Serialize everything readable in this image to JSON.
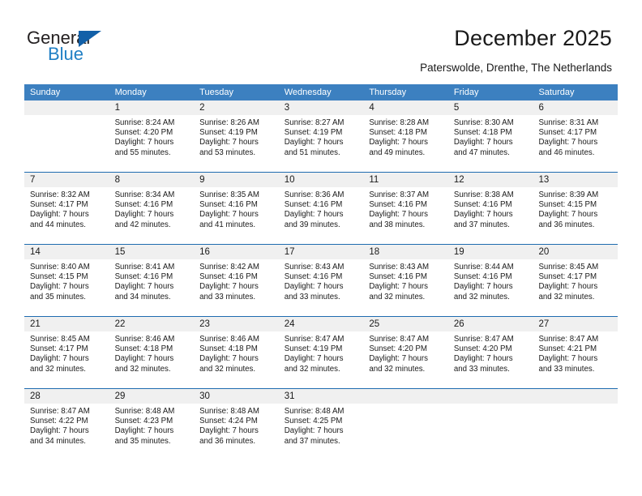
{
  "brand": {
    "name_part1": "General",
    "name_part2": "Blue",
    "logo_icon": "triangle-flag-icon",
    "accent_color": "#1260a8",
    "blue_text_color": "#1f7fc4"
  },
  "header": {
    "title": "December 2025",
    "subtitle": "Paterswolde, Drenthe, The Netherlands"
  },
  "calendar": {
    "header_bg": "#3c80c0",
    "separator_color": "#1f6cb0",
    "daynum_band_bg": "#f0f0f0",
    "weekdays": [
      "Sunday",
      "Monday",
      "Tuesday",
      "Wednesday",
      "Thursday",
      "Friday",
      "Saturday"
    ],
    "weeks": [
      [
        {
          "day": "",
          "sunrise": "",
          "sunset": "",
          "daylight_line1": "",
          "daylight_line2": ""
        },
        {
          "day": "1",
          "sunrise": "Sunrise: 8:24 AM",
          "sunset": "Sunset: 4:20 PM",
          "daylight_line1": "Daylight: 7 hours",
          "daylight_line2": "and 55 minutes."
        },
        {
          "day": "2",
          "sunrise": "Sunrise: 8:26 AM",
          "sunset": "Sunset: 4:19 PM",
          "daylight_line1": "Daylight: 7 hours",
          "daylight_line2": "and 53 minutes."
        },
        {
          "day": "3",
          "sunrise": "Sunrise: 8:27 AM",
          "sunset": "Sunset: 4:19 PM",
          "daylight_line1": "Daylight: 7 hours",
          "daylight_line2": "and 51 minutes."
        },
        {
          "day": "4",
          "sunrise": "Sunrise: 8:28 AM",
          "sunset": "Sunset: 4:18 PM",
          "daylight_line1": "Daylight: 7 hours",
          "daylight_line2": "and 49 minutes."
        },
        {
          "day": "5",
          "sunrise": "Sunrise: 8:30 AM",
          "sunset": "Sunset: 4:18 PM",
          "daylight_line1": "Daylight: 7 hours",
          "daylight_line2": "and 47 minutes."
        },
        {
          "day": "6",
          "sunrise": "Sunrise: 8:31 AM",
          "sunset": "Sunset: 4:17 PM",
          "daylight_line1": "Daylight: 7 hours",
          "daylight_line2": "and 46 minutes."
        }
      ],
      [
        {
          "day": "7",
          "sunrise": "Sunrise: 8:32 AM",
          "sunset": "Sunset: 4:17 PM",
          "daylight_line1": "Daylight: 7 hours",
          "daylight_line2": "and 44 minutes."
        },
        {
          "day": "8",
          "sunrise": "Sunrise: 8:34 AM",
          "sunset": "Sunset: 4:16 PM",
          "daylight_line1": "Daylight: 7 hours",
          "daylight_line2": "and 42 minutes."
        },
        {
          "day": "9",
          "sunrise": "Sunrise: 8:35 AM",
          "sunset": "Sunset: 4:16 PM",
          "daylight_line1": "Daylight: 7 hours",
          "daylight_line2": "and 41 minutes."
        },
        {
          "day": "10",
          "sunrise": "Sunrise: 8:36 AM",
          "sunset": "Sunset: 4:16 PM",
          "daylight_line1": "Daylight: 7 hours",
          "daylight_line2": "and 39 minutes."
        },
        {
          "day": "11",
          "sunrise": "Sunrise: 8:37 AM",
          "sunset": "Sunset: 4:16 PM",
          "daylight_line1": "Daylight: 7 hours",
          "daylight_line2": "and 38 minutes."
        },
        {
          "day": "12",
          "sunrise": "Sunrise: 8:38 AM",
          "sunset": "Sunset: 4:16 PM",
          "daylight_line1": "Daylight: 7 hours",
          "daylight_line2": "and 37 minutes."
        },
        {
          "day": "13",
          "sunrise": "Sunrise: 8:39 AM",
          "sunset": "Sunset: 4:15 PM",
          "daylight_line1": "Daylight: 7 hours",
          "daylight_line2": "and 36 minutes."
        }
      ],
      [
        {
          "day": "14",
          "sunrise": "Sunrise: 8:40 AM",
          "sunset": "Sunset: 4:15 PM",
          "daylight_line1": "Daylight: 7 hours",
          "daylight_line2": "and 35 minutes."
        },
        {
          "day": "15",
          "sunrise": "Sunrise: 8:41 AM",
          "sunset": "Sunset: 4:16 PM",
          "daylight_line1": "Daylight: 7 hours",
          "daylight_line2": "and 34 minutes."
        },
        {
          "day": "16",
          "sunrise": "Sunrise: 8:42 AM",
          "sunset": "Sunset: 4:16 PM",
          "daylight_line1": "Daylight: 7 hours",
          "daylight_line2": "and 33 minutes."
        },
        {
          "day": "17",
          "sunrise": "Sunrise: 8:43 AM",
          "sunset": "Sunset: 4:16 PM",
          "daylight_line1": "Daylight: 7 hours",
          "daylight_line2": "and 33 minutes."
        },
        {
          "day": "18",
          "sunrise": "Sunrise: 8:43 AM",
          "sunset": "Sunset: 4:16 PM",
          "daylight_line1": "Daylight: 7 hours",
          "daylight_line2": "and 32 minutes."
        },
        {
          "day": "19",
          "sunrise": "Sunrise: 8:44 AM",
          "sunset": "Sunset: 4:16 PM",
          "daylight_line1": "Daylight: 7 hours",
          "daylight_line2": "and 32 minutes."
        },
        {
          "day": "20",
          "sunrise": "Sunrise: 8:45 AM",
          "sunset": "Sunset: 4:17 PM",
          "daylight_line1": "Daylight: 7 hours",
          "daylight_line2": "and 32 minutes."
        }
      ],
      [
        {
          "day": "21",
          "sunrise": "Sunrise: 8:45 AM",
          "sunset": "Sunset: 4:17 PM",
          "daylight_line1": "Daylight: 7 hours",
          "daylight_line2": "and 32 minutes."
        },
        {
          "day": "22",
          "sunrise": "Sunrise: 8:46 AM",
          "sunset": "Sunset: 4:18 PM",
          "daylight_line1": "Daylight: 7 hours",
          "daylight_line2": "and 32 minutes."
        },
        {
          "day": "23",
          "sunrise": "Sunrise: 8:46 AM",
          "sunset": "Sunset: 4:18 PM",
          "daylight_line1": "Daylight: 7 hours",
          "daylight_line2": "and 32 minutes."
        },
        {
          "day": "24",
          "sunrise": "Sunrise: 8:47 AM",
          "sunset": "Sunset: 4:19 PM",
          "daylight_line1": "Daylight: 7 hours",
          "daylight_line2": "and 32 minutes."
        },
        {
          "day": "25",
          "sunrise": "Sunrise: 8:47 AM",
          "sunset": "Sunset: 4:20 PM",
          "daylight_line1": "Daylight: 7 hours",
          "daylight_line2": "and 32 minutes."
        },
        {
          "day": "26",
          "sunrise": "Sunrise: 8:47 AM",
          "sunset": "Sunset: 4:20 PM",
          "daylight_line1": "Daylight: 7 hours",
          "daylight_line2": "and 33 minutes."
        },
        {
          "day": "27",
          "sunrise": "Sunrise: 8:47 AM",
          "sunset": "Sunset: 4:21 PM",
          "daylight_line1": "Daylight: 7 hours",
          "daylight_line2": "and 33 minutes."
        }
      ],
      [
        {
          "day": "28",
          "sunrise": "Sunrise: 8:47 AM",
          "sunset": "Sunset: 4:22 PM",
          "daylight_line1": "Daylight: 7 hours",
          "daylight_line2": "and 34 minutes."
        },
        {
          "day": "29",
          "sunrise": "Sunrise: 8:48 AM",
          "sunset": "Sunset: 4:23 PM",
          "daylight_line1": "Daylight: 7 hours",
          "daylight_line2": "and 35 minutes."
        },
        {
          "day": "30",
          "sunrise": "Sunrise: 8:48 AM",
          "sunset": "Sunset: 4:24 PM",
          "daylight_line1": "Daylight: 7 hours",
          "daylight_line2": "and 36 minutes."
        },
        {
          "day": "31",
          "sunrise": "Sunrise: 8:48 AM",
          "sunset": "Sunset: 4:25 PM",
          "daylight_line1": "Daylight: 7 hours",
          "daylight_line2": "and 37 minutes."
        },
        {
          "day": "",
          "sunrise": "",
          "sunset": "",
          "daylight_line1": "",
          "daylight_line2": ""
        },
        {
          "day": "",
          "sunrise": "",
          "sunset": "",
          "daylight_line1": "",
          "daylight_line2": ""
        },
        {
          "day": "",
          "sunrise": "",
          "sunset": "",
          "daylight_line1": "",
          "daylight_line2": ""
        }
      ]
    ]
  }
}
